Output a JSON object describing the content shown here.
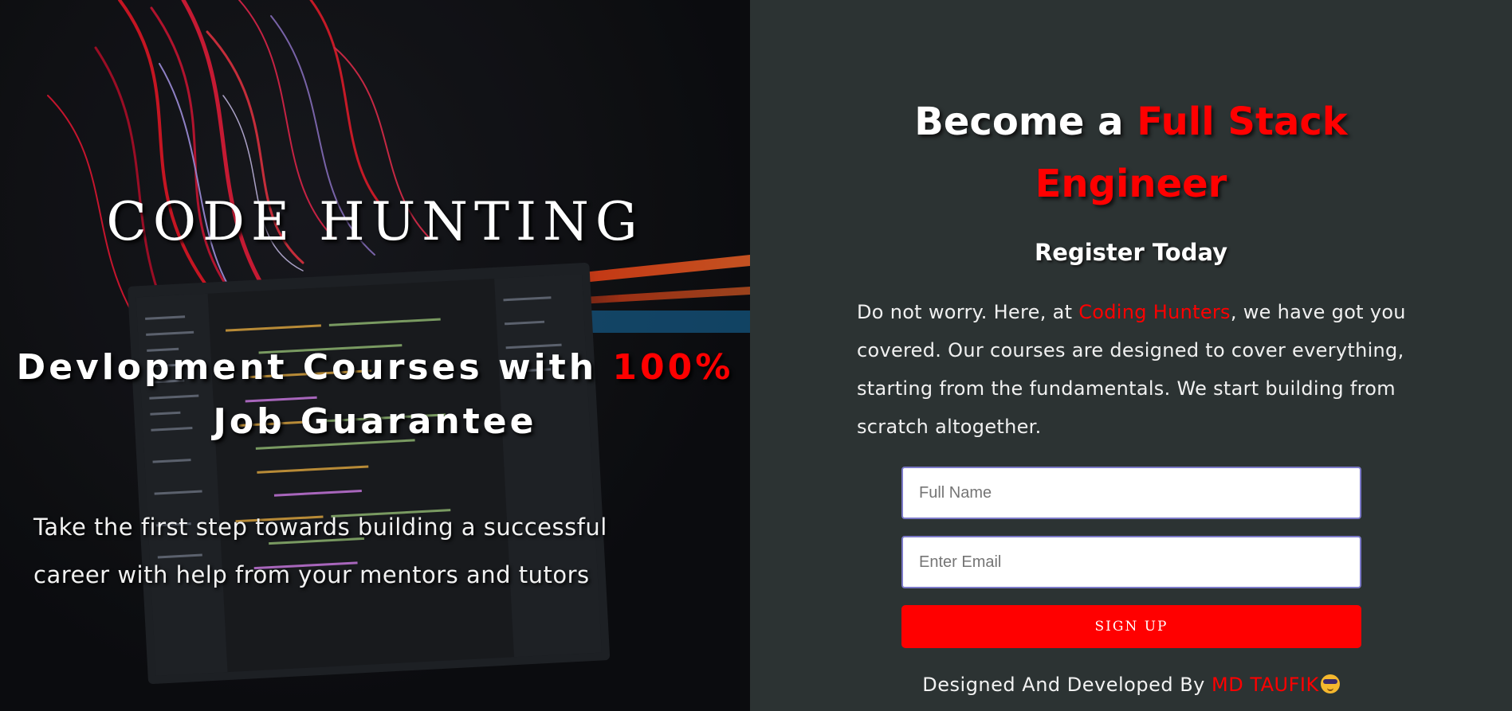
{
  "hero": {
    "brand": "CODE HUNTING",
    "headline_pre": "Devlopment Courses with ",
    "headline_accent": "100%",
    "headline_post": "Job Guarantee",
    "lead": "Take the first step towards building a successful career with help from your mentors and tutors"
  },
  "register": {
    "title_pre": "Become a ",
    "title_accent": "Full Stack Engineer",
    "subtitle": "Register Today",
    "desc_pre": "Do not worry. Here, at ",
    "desc_link": "Coding Hunters",
    "desc_post": ", we have got you covered. Our courses are designed to cover everything, starting from the fundamentals. We start building from scratch altogether.",
    "name_placeholder": "Full Name",
    "email_placeholder": "Enter Email",
    "signup_label": "SIGN UP"
  },
  "footer": {
    "credit_pre": "Designed And Developed By ",
    "credit_name": "MD TAUFIK",
    "credit_icon": "smiling-face-with-sunglasses-icon"
  },
  "colors": {
    "accent": "#ff0000",
    "panel_bg": "#2c3333",
    "field_border": "#7b79c8"
  }
}
